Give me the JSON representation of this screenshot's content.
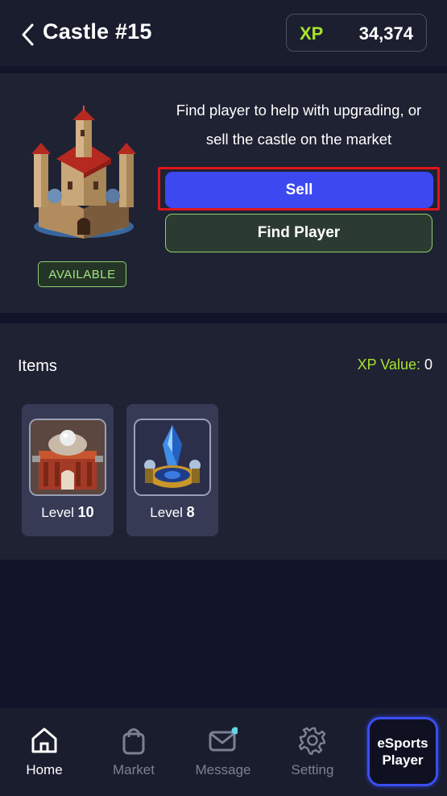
{
  "header": {
    "title": "Castle #15",
    "xp_label": "XP",
    "xp_value": "34,374"
  },
  "castle": {
    "status": "AVAILABLE",
    "description_line1": "Find player to help with upgrading, or",
    "description_line2": "sell the castle on the market",
    "sell_label": "Sell",
    "find_player_label": "Find Player"
  },
  "items": {
    "heading": "Items",
    "xp_value_label": "XP Value:",
    "xp_value": "0",
    "list": [
      {
        "level_prefix": "Level",
        "level": "10"
      },
      {
        "level_prefix": "Level",
        "level": "8"
      }
    ]
  },
  "nav": {
    "items": [
      {
        "label": "Home",
        "icon": "home-icon"
      },
      {
        "label": "Market",
        "icon": "shopping-bag-icon"
      },
      {
        "label": "Message",
        "icon": "mail-icon"
      },
      {
        "label": "Setting",
        "icon": "gear-icon"
      }
    ],
    "esports_line1": "eSports",
    "esports_line2": "Player"
  },
  "colors": {
    "accent_green": "#a7e22e",
    "primary_blue": "#3d49f0",
    "highlight_red": "#e0151b",
    "background": "#12152a"
  }
}
